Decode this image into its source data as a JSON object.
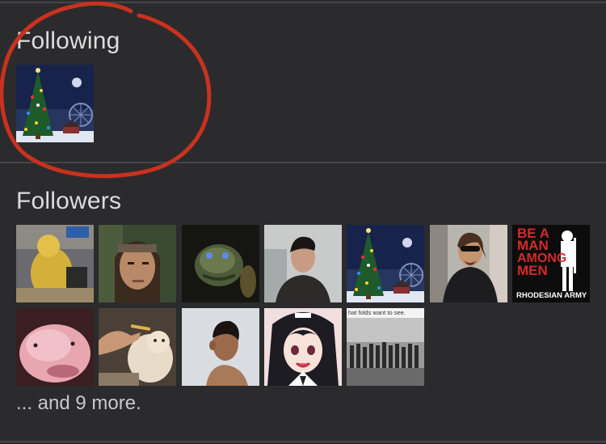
{
  "following": {
    "heading": "Following",
    "avatars": [
      {
        "icon": "christmas-tree-night-avatar"
      }
    ]
  },
  "followers": {
    "heading": "Followers",
    "avatars": [
      {
        "icon": "yellow-costume-avatar"
      },
      {
        "icon": "barbarian-warrior-avatar"
      },
      {
        "icon": "green-alien-creature-avatar"
      },
      {
        "icon": "young-man-portrait-avatar"
      },
      {
        "icon": "christmas-tree-night-avatar"
      },
      {
        "icon": "man-sunglasses-suit-avatar"
      },
      {
        "icon": "poster-text-soldier-avatar",
        "text": [
          "BE A",
          "MAN",
          "AMONG",
          "MEN",
          "RHODESIAN ARMY"
        ]
      },
      {
        "icon": "pink-blobfish-avatar"
      },
      {
        "icon": "hand-feeding-cat-avatar"
      },
      {
        "icon": "man-profile-avatar"
      },
      {
        "icon": "anime-girl-avatar"
      },
      {
        "icon": "meme-crowd-photo-avatar",
        "text": [
          "hat folds want to see."
        ]
      }
    ],
    "more_text": "... and 9 more."
  },
  "colors": {
    "background": "#2b2b2d",
    "divider": "#454548",
    "annotation_circle": "#c8321e"
  }
}
